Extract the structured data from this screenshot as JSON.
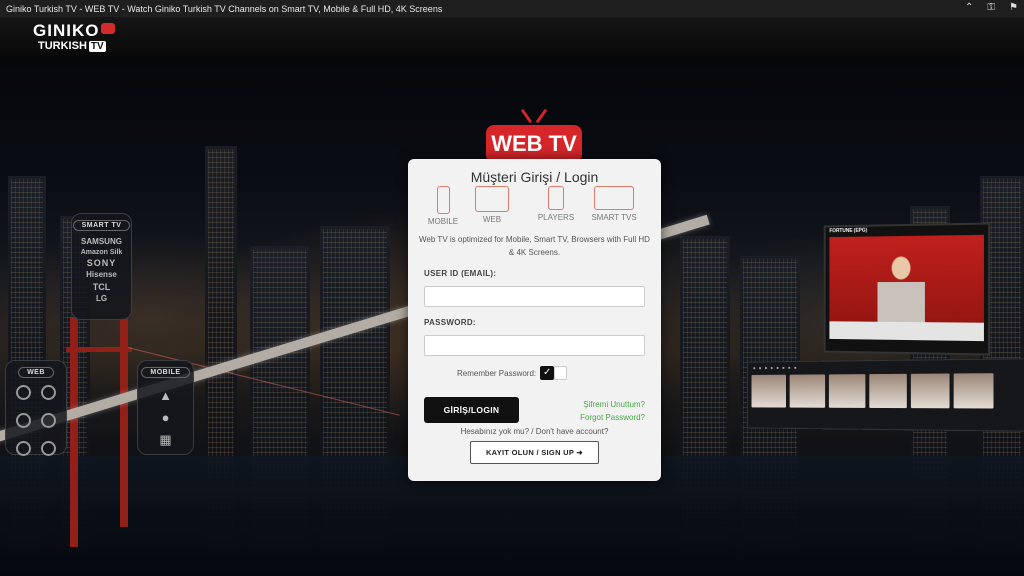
{
  "window": {
    "title": "Giniko Turkish TV - WEB TV - Watch Giniko Turkish TV Channels on Smart TV, Mobile & Full HD, 4K Screens",
    "icons": [
      "chevron-up-icon",
      "key-icon",
      "puzzle-icon"
    ]
  },
  "logo": {
    "line1": "GINIKO",
    "line2": "TURKISH",
    "tv": "TV"
  },
  "badge": {
    "text": "WEB TV",
    "color": "#d6262a"
  },
  "panels": {
    "smart_tv": {
      "title": "SMART TV",
      "brands": [
        "SAMSUNG",
        "Amazon Silk",
        "SONY",
        "Hisense",
        "TCL",
        "LG"
      ]
    },
    "web": {
      "title": "WEB",
      "icons": [
        "ie-icon",
        "chrome-icon",
        "edge-icon",
        "firefox-icon",
        "opera-icon",
        "safari-icon"
      ]
    },
    "mobile": {
      "title": "MOBILE",
      "icons": [
        "android-icon",
        "apple-icon",
        "windows-icon"
      ]
    }
  },
  "login": {
    "title": "Müşteri Girişi / Login",
    "devices": [
      "MOBILE",
      "WEB",
      "PLAYERS",
      "SMART TVS"
    ],
    "description": "Web TV is optimized for Mobile, Smart TV, Browsers with Full HD & 4K Screens.",
    "user_label": "USER ID (EMAIL):",
    "user_value": "",
    "password_label": "PASSWORD:",
    "password_value": "",
    "remember_label": "Remember Password:",
    "remember_checked": true,
    "login_button": "GİRİŞ/LOGIN",
    "forgot_tr": "Şifremi Unuttum?",
    "forgot_en": "Forgot Password?",
    "no_account": "Hesabınız yok mu? / Don't have account?",
    "signup_button": "KAYIT OLUN / SIGN UP ➜"
  },
  "preview": {
    "channel": "FORTUNE (EPG)"
  },
  "colors": {
    "accent": "#d6262a",
    "link": "#4aa64a",
    "button": "#111111"
  }
}
